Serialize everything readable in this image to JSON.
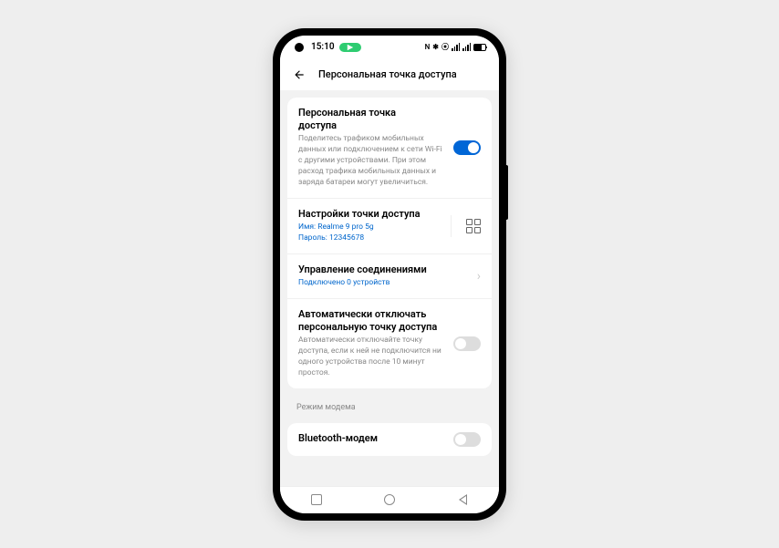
{
  "status": {
    "time": "15:10",
    "nfc": "N",
    "bt": "⁂",
    "vibrate": "⦾"
  },
  "header": {
    "title": "Персональная точка доступа"
  },
  "hotspot": {
    "title": "Персональная точка\nдоступа",
    "desc": "Поделитесь трафиком мобильных данных или подключением к сети Wi-Fi с другими устройствами. При этом расход трафика мобильных данных и заряда батареи могут увеличиться."
  },
  "settings": {
    "title": "Настройки точки доступа",
    "name_label": "Имя:",
    "name_value": "Realme 9 pro 5g",
    "pass_label": "Пароль:",
    "pass_value": "12345678"
  },
  "connections": {
    "title": "Управление соединениями",
    "sub": "Подключено 0 устройств"
  },
  "auto_off": {
    "title": "Автоматически отключать персональную точку доступа",
    "desc": "Автоматически отключайте точку доступа, если к ней не подключится ни одного устройства после 10 минут простоя."
  },
  "section": {
    "modem_mode": "Режим модема"
  },
  "bt_modem": {
    "title": "Bluetooth-модем"
  }
}
